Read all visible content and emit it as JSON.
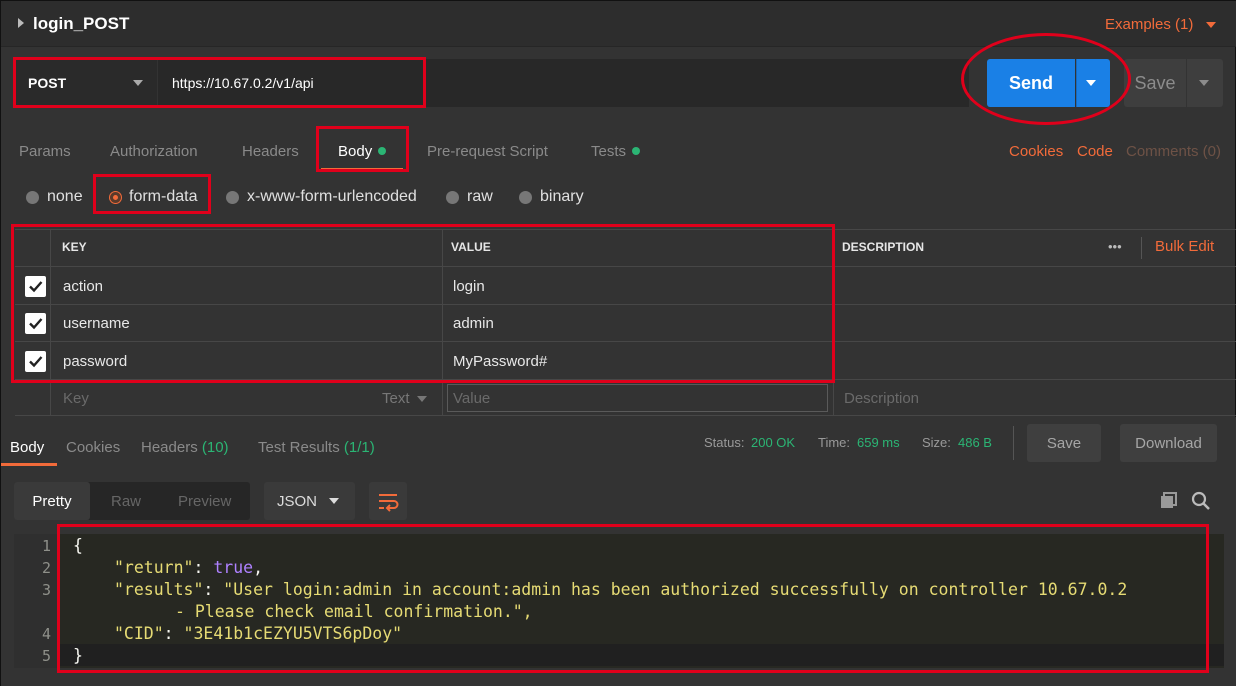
{
  "request": {
    "name": "login_POST",
    "examples_label": "Examples (1)",
    "method": "POST",
    "url": "https://10.67.0.2/v1/api",
    "send_label": "Send",
    "save_label": "Save"
  },
  "request_tabs": [
    {
      "label": "Params",
      "active": false
    },
    {
      "label": "Authorization",
      "active": false
    },
    {
      "label": "Headers",
      "active": false
    },
    {
      "label": "Body",
      "active": true,
      "dot": true
    },
    {
      "label": "Pre-request Script",
      "active": false
    },
    {
      "label": "Tests",
      "active": false,
      "dot": true
    }
  ],
  "right_links": {
    "cookies": "Cookies",
    "code": "Code",
    "comments": "Comments (0)"
  },
  "body_types": [
    {
      "label": "none",
      "selected": false
    },
    {
      "label": "form-data",
      "selected": true
    },
    {
      "label": "x-www-form-urlencoded",
      "selected": false
    },
    {
      "label": "raw",
      "selected": false
    },
    {
      "label": "binary",
      "selected": false
    }
  ],
  "params_table": {
    "headers": {
      "key": "KEY",
      "value": "VALUE",
      "description": "DESCRIPTION"
    },
    "more_label": "•••",
    "bulk_edit_label": "Bulk Edit",
    "rows": [
      {
        "checked": true,
        "key": "action",
        "value": "login",
        "description": ""
      },
      {
        "checked": true,
        "key": "username",
        "value": "admin",
        "description": ""
      },
      {
        "checked": true,
        "key": "password",
        "value": "MyPassword#",
        "description": ""
      }
    ],
    "new_row": {
      "key_placeholder": "Key",
      "type_label": "Text",
      "value_placeholder": "Value",
      "description_placeholder": "Description"
    }
  },
  "response": {
    "tabs": [
      {
        "label": "Body",
        "active": true
      },
      {
        "label": "Cookies",
        "active": false
      },
      {
        "label": "Headers",
        "count": "(10)"
      },
      {
        "label": "Test Results",
        "count": "(1/1)"
      }
    ],
    "status_label": "Status:",
    "status_value": "200 OK",
    "time_label": "Time:",
    "time_value": "659 ms",
    "size_label": "Size:",
    "size_value": "486 B",
    "save_label": "Save",
    "download_label": "Download",
    "view_modes": [
      "Pretty",
      "Raw",
      "Preview"
    ],
    "format": "JSON",
    "code_lines": [
      {
        "n": "1",
        "text": "{"
      },
      {
        "n": "2",
        "key": "\"return\"",
        "value": "true"
      },
      {
        "n": "3",
        "key": "\"results\"",
        "value": "\"User login:admin in account:admin has been authorized successfully on controller 10.67.0.2",
        "cont": "- Please check email confirmation.\","
      },
      {
        "n": "4",
        "key": "\"CID\"",
        "value": "\"3E41b1cEZYU5VTS6pDoy\""
      },
      {
        "n": "5",
        "text": "}"
      }
    ]
  },
  "colors": {
    "accent": "#f26b3a",
    "send": "#1a80e6",
    "success": "#2bb574",
    "annotation": "#e0001b"
  }
}
